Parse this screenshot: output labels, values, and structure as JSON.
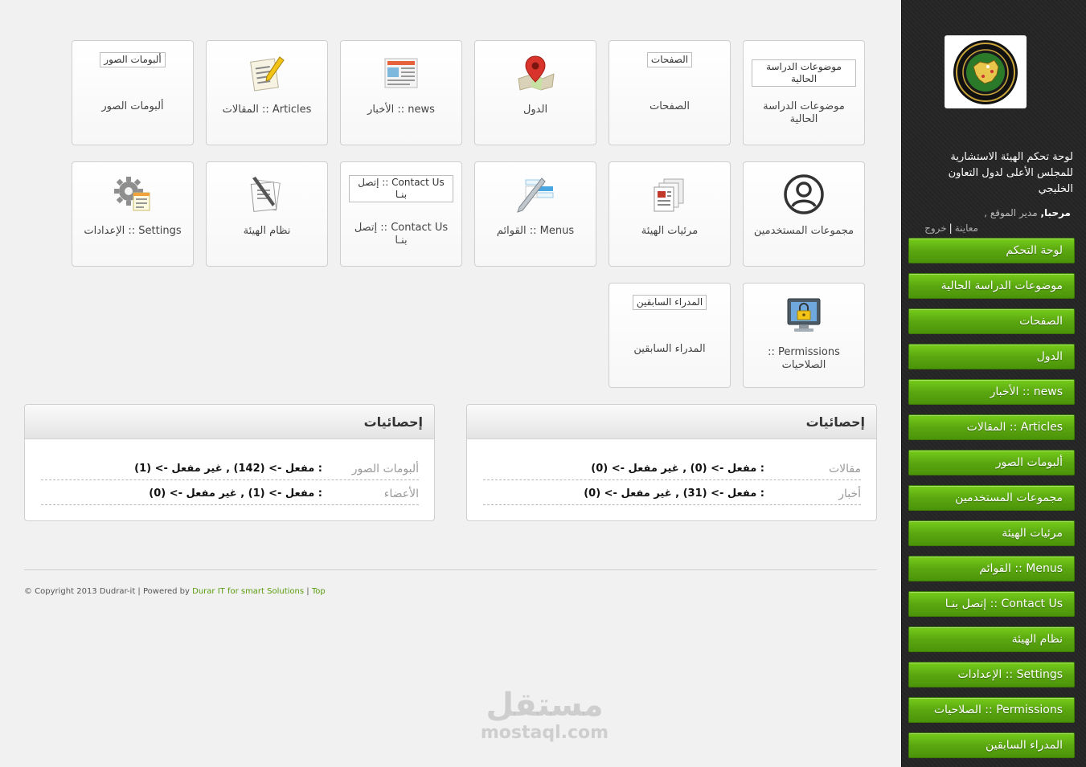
{
  "sidebar": {
    "site_title": "لوحة تحكم الهيئة الاستشارية للمجلس الأعلى لدول التعاون الخليجي",
    "welcome_hello": "مرحبا,",
    "welcome_role": "مدير الموقع ,",
    "preview_link": "معاينة",
    "separator": "|",
    "logout_link": "خروج",
    "nav": [
      {
        "label": "لوحة التحكم"
      },
      {
        "label": "موضوعات الدراسة الحالية"
      },
      {
        "label": "الصفحات"
      },
      {
        "label": "الدول"
      },
      {
        "label": "news :: الأخبار"
      },
      {
        "label": "Articles :: المقالات"
      },
      {
        "label": "ألبومات الصور"
      },
      {
        "label": "مجموعات المستخدمين"
      },
      {
        "label": "مرئيات الهيئة"
      },
      {
        "label": "Menus :: القوائم"
      },
      {
        "label": "Contact Us :: إتصل بنـا"
      },
      {
        "label": "نظام الهيئة"
      },
      {
        "label": "Settings :: الإعدادات"
      },
      {
        "label": "Permissions :: الصلاحيات"
      },
      {
        "label": "المدراء السابقين"
      }
    ]
  },
  "tiles": {
    "studies": {
      "label": "موضوعات الدراسة الحالية",
      "alt": "موضوعات الدراسة الحالية"
    },
    "pages": {
      "label": "الصفحات",
      "alt": "الصفحات"
    },
    "countries": {
      "label": "الدول",
      "icon": "map-pin-icon"
    },
    "news": {
      "label": "news :: الأخبار",
      "icon": "newspaper-icon"
    },
    "articles": {
      "label": "Articles :: المقالات",
      "icon": "article-pencil-icon"
    },
    "albums": {
      "label": "ألبومات الصور",
      "alt": "ألبومات الصور"
    },
    "user_groups": {
      "label": "مجموعات المستخدمين",
      "icon": "user-circle-icon"
    },
    "visuals": {
      "label": "مرئيات الهيئة",
      "icon": "documents-icon"
    },
    "menus": {
      "label": "Menus :: القوائم",
      "icon": "menu-edit-icon"
    },
    "contact": {
      "label": "Contact Us :: إتصل بنـا",
      "alt": "Contact Us :: إتصل بنـا"
    },
    "system": {
      "label": "نظام الهيئة",
      "icon": "document-pen-icon"
    },
    "settings": {
      "label": "Settings :: الإعدادات",
      "icon": "gear-list-icon"
    },
    "permissions": {
      "label": "Permissions :: الصلاحيات",
      "icon": "monitor-lock-icon"
    },
    "former_managers": {
      "label": "المدراء السابقين",
      "alt": "المدراء السابقين"
    }
  },
  "stats": {
    "right": {
      "title": "إحصائيات",
      "rows": [
        {
          "key": "مقالات",
          "value": ": مفعل -> (0) , غير مفعل -> (0)"
        },
        {
          "key": "أخبار",
          "value": ": مفعل -> (31) , غير مفعل -> (0)"
        }
      ]
    },
    "left": {
      "title": "إحصائيات",
      "rows": [
        {
          "key": "ألبومات الصور",
          "value": ": مفعل -> (142) , غير مفعل -> (1)"
        },
        {
          "key": "الأعضاء",
          "value": ": مفعل -> (1) , غير مفعل -> (0)"
        }
      ]
    }
  },
  "footer": {
    "copyright": "© Copyright 2013 Dudrar-it | Powered by ",
    "powered_link": "Durar IT for smart Solutions",
    "sep": " | ",
    "top_link": "Top"
  },
  "watermark": {
    "arabic": "مستقل",
    "latin": "mostaql.com"
  },
  "colors": {
    "nav_green": "#5ba711",
    "sidebar_bg": "#242424",
    "link_green": "#5a9b10"
  }
}
